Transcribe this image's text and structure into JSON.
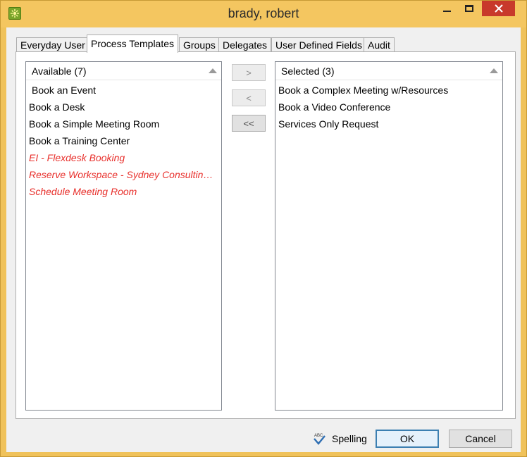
{
  "window": {
    "title": "brady, robert",
    "icon": "app-flower-icon",
    "controls": [
      "minimize-icon",
      "maximize-icon",
      "close-icon"
    ]
  },
  "tabs": [
    {
      "label": "Everyday User",
      "active": false
    },
    {
      "label": "Process Templates",
      "active": true
    },
    {
      "label": "Groups",
      "active": false
    },
    {
      "label": "Delegates",
      "active": false
    },
    {
      "label": "User Defined Fields",
      "active": false
    },
    {
      "label": "Audit",
      "active": false
    }
  ],
  "available": {
    "header": "Available (7)",
    "items": [
      {
        "label": "Book an Event",
        "style": "normal"
      },
      {
        "label": "Book a Desk",
        "style": "normal"
      },
      {
        "label": "Book a Simple Meeting Room",
        "style": "normal"
      },
      {
        "label": "Book a Training Center",
        "style": "normal"
      },
      {
        "label": "EI - Flexdesk Booking",
        "style": "red"
      },
      {
        "label": "Reserve Workspace - Sydney Consulting G...",
        "style": "red"
      },
      {
        "label": "Schedule Meeting Room",
        "style": "red"
      }
    ]
  },
  "selected": {
    "header": "Selected (3)",
    "items": [
      {
        "label": "Book a Complex Meeting w/Resources"
      },
      {
        "label": "Book a Video Conference"
      },
      {
        "label": "Services Only Request"
      }
    ]
  },
  "move_buttons": {
    "add": ">",
    "remove": "<",
    "remove_all": "<<"
  },
  "footer": {
    "spelling": "Spelling",
    "ok": "OK",
    "cancel": "Cancel"
  },
  "colors": {
    "title_bar": "#f4c660",
    "close_button": "#c8392b",
    "error_item": "#e8302c",
    "default_button_border": "#3c7fb1"
  }
}
